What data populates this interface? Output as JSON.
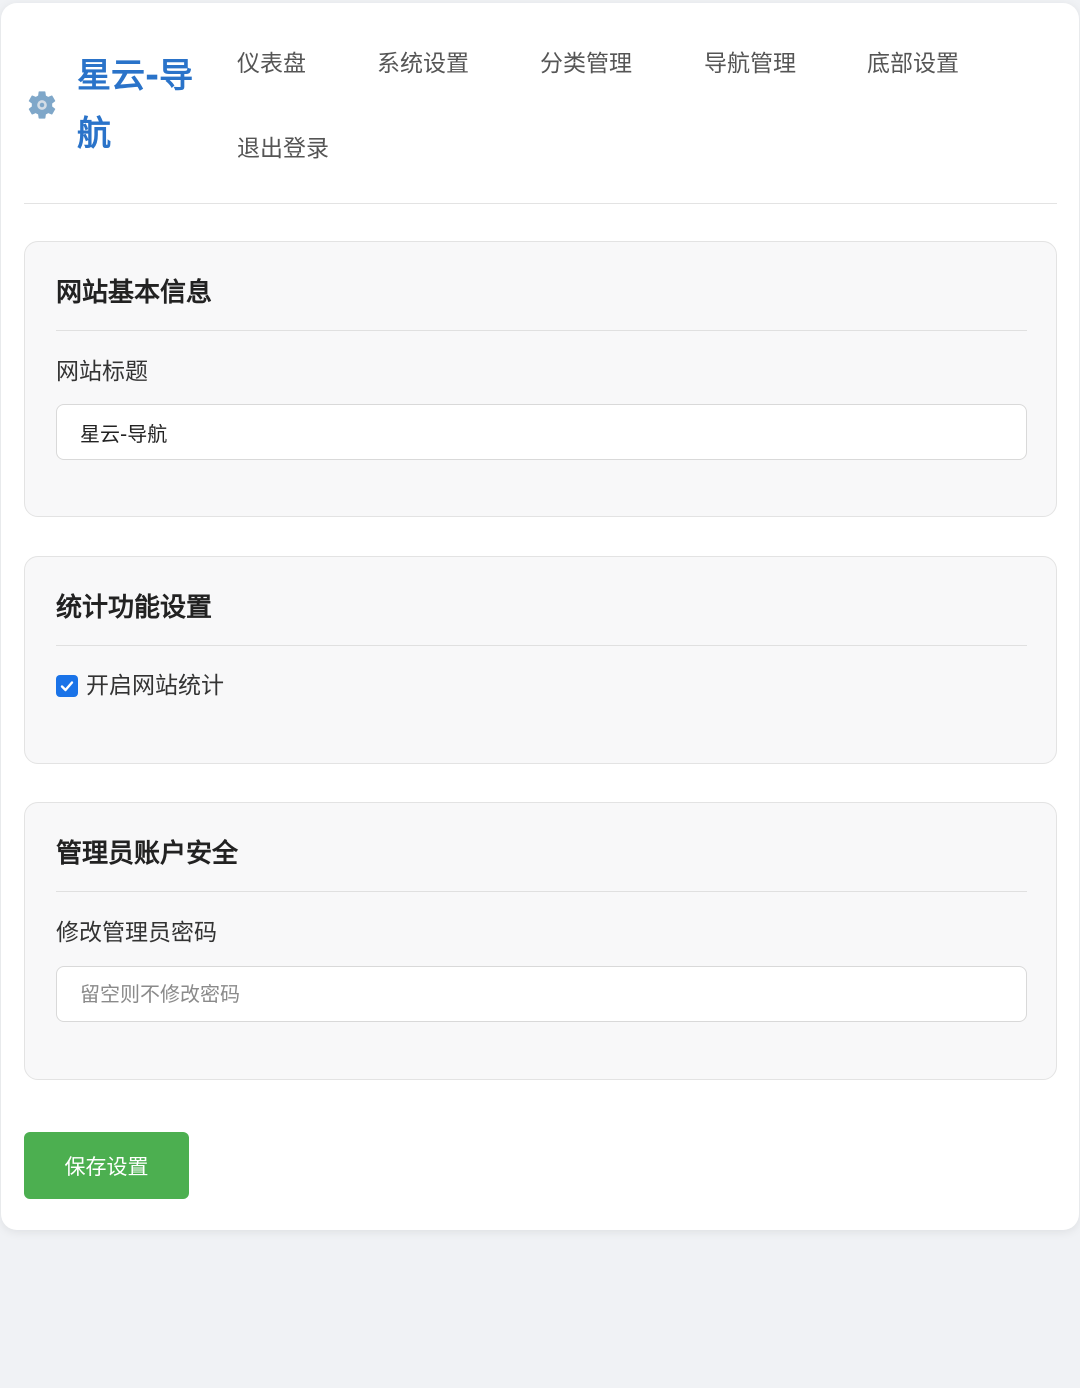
{
  "header": {
    "brand_icon": "gear-icon",
    "brand_title": "星云-导航",
    "nav": [
      {
        "label": "仪表盘"
      },
      {
        "label": "系统设置"
      },
      {
        "label": "分类管理"
      },
      {
        "label": "导航管理"
      },
      {
        "label": "底部设置"
      },
      {
        "label": "退出登录"
      }
    ]
  },
  "sections": {
    "basic": {
      "title": "网站基本信息",
      "site_title_label": "网站标题",
      "site_title_value": "星云-导航"
    },
    "stats": {
      "title": "统计功能设置",
      "enable_label": "开启网站统计",
      "enabled": true
    },
    "security": {
      "title": "管理员账户安全",
      "password_label": "修改管理员密码",
      "password_placeholder": "留空则不修改密码",
      "password_value": ""
    }
  },
  "actions": {
    "save_label": "保存设置"
  },
  "colors": {
    "brand": "#2a73c9",
    "save_button": "#4caf50",
    "checkbox": "#1a73e8",
    "page_background": "#f0f2f5"
  }
}
